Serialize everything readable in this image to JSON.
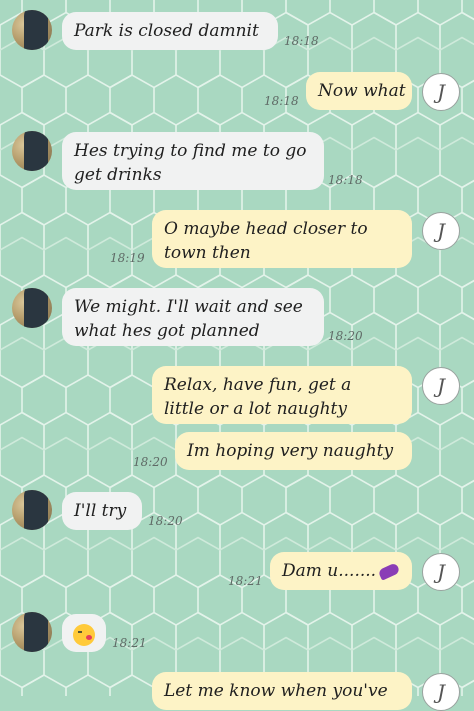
{
  "colors": {
    "background": "#a9d8c1",
    "incoming_bubble": "#f1f2f2",
    "outgoing_bubble": "#fdf3c6",
    "timestamp": "#5f6a66"
  },
  "icons": {
    "outgoing_avatar": "letter-j-badge",
    "incoming_avatar": "contact-photo-redacted",
    "emoji_kiss": "face-blowing-kiss-emoji",
    "emoji_eggplant": "eggplant-emoji"
  },
  "messages": [
    {
      "sender": "them",
      "text": "Park is closed damnit",
      "time": "18:18"
    },
    {
      "sender": "me",
      "avatar_letter": "J",
      "text": "Now what",
      "time": "18:18"
    },
    {
      "sender": "them",
      "line1": "Hes trying to find me to go",
      "line2": "get drinks",
      "time": "18:18"
    },
    {
      "sender": "me",
      "avatar_letter": "J",
      "line1": "O maybe head closer to",
      "line2": "town then",
      "time": "18:19"
    },
    {
      "sender": "them",
      "line1": "We might. I'll wait and see",
      "line2": "what hes got planned",
      "time": "18:20"
    },
    {
      "sender": "me",
      "avatar_letter": "J",
      "line1": "Relax, have fun, get a",
      "line2": "little or a lot naughty"
    },
    {
      "sender": "me",
      "text": "Im hoping very naughty",
      "time": "18:20"
    },
    {
      "sender": "them",
      "text": "I'll try",
      "time": "18:20"
    },
    {
      "sender": "me",
      "avatar_letter": "J",
      "text": "Dam u.......",
      "time": "18:21"
    },
    {
      "sender": "them",
      "time": "18:21"
    },
    {
      "sender": "me",
      "avatar_letter": "J",
      "text": "Let me know when you've"
    }
  ]
}
